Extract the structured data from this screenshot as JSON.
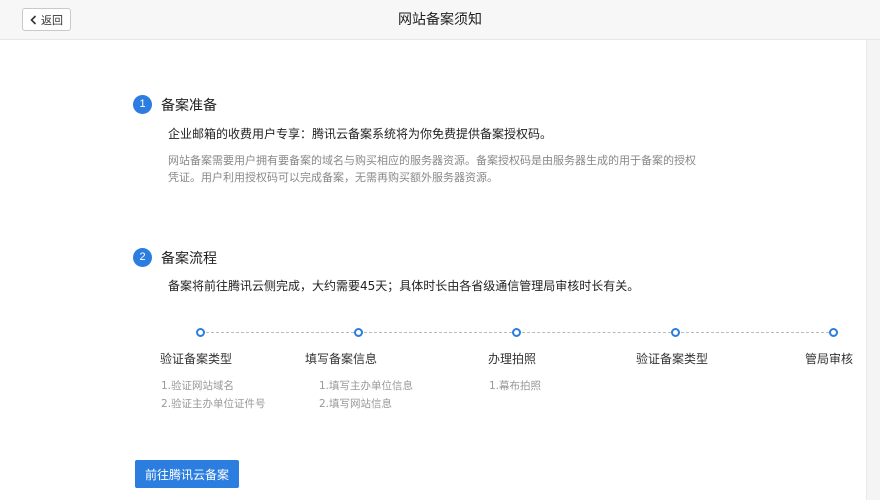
{
  "header": {
    "back_label": "返回",
    "title": "网站备案须知"
  },
  "sections": [
    {
      "number": "1",
      "title": "备案准备",
      "lead": "企业邮箱的收费用户专享：腾讯云备案系统将为你免费提供备案授权码。",
      "desc": [
        "网站备案需要用户拥有要备案的域名与购买相应的服务器资源。备案授权码是由服务器生成的用于备案的授权",
        "凭证。用户利用授权码可以完成备案，无需再购买额外服务器资源。"
      ]
    },
    {
      "number": "2",
      "title": "备案流程",
      "lead": "备案将前往腾讯云侧完成，大约需要45天；具体时长由各省级通信管理局审核时长有关。"
    }
  ],
  "flow": [
    {
      "label": "验证备案类型",
      "items": [
        "1.验证网站域名",
        "2.验证主办单位证件号"
      ]
    },
    {
      "label": "填写备案信息",
      "items": [
        "1.填写主办单位信息",
        "2.填写网站信息"
      ]
    },
    {
      "label": "办理拍照",
      "items": [
        "1.幕布拍照"
      ]
    },
    {
      "label": "验证备案类型",
      "items": []
    },
    {
      "label": "管局审核",
      "items": []
    }
  ],
  "cta_label": "前往腾讯云备案",
  "colors": {
    "accent": "#2b7ddf"
  }
}
